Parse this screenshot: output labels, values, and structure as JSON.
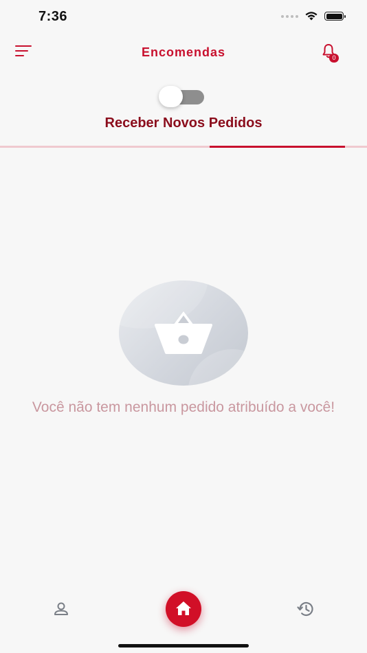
{
  "status_bar": {
    "time": "7:36"
  },
  "header": {
    "title": "Encomendas",
    "notification_count": "0"
  },
  "toggle": {
    "state": "off"
  },
  "tabs": [
    {
      "label": "Receber Novos Pedidos",
      "active": false
    }
  ],
  "empty_state": {
    "message": "Você não tem nenhum pedido atribuído a você!"
  },
  "bottom_nav": {
    "items": [
      "profile-icon",
      "home-icon",
      "history-icon"
    ],
    "active": "home"
  },
  "colors": {
    "brand": "#c8102e",
    "tab_text": "#8b0d1c",
    "empty_text": "#c9979f"
  }
}
